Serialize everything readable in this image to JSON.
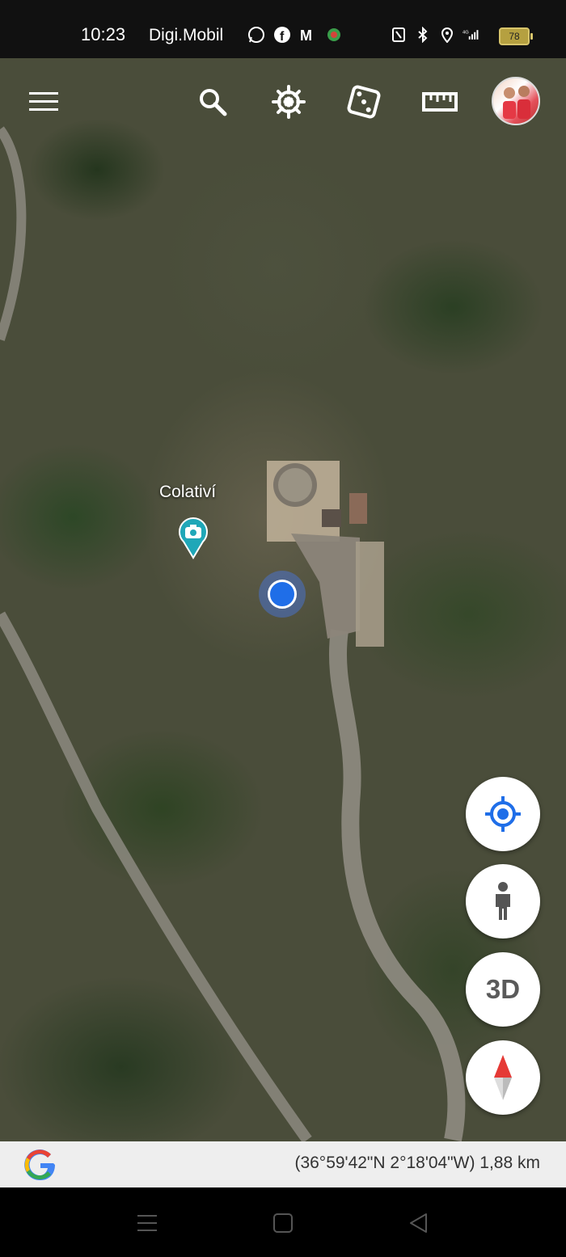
{
  "status_bar": {
    "time": "10:23",
    "carrier": "Digi.Mobil",
    "battery_level": "78",
    "app_icons": [
      "whatsapp-icon",
      "facebook-icon",
      "gmail-icon",
      "app-notification-icon"
    ],
    "system_icons": [
      "nfc-icon",
      "bluetooth-icon",
      "location-icon",
      "signal-4g-icon"
    ]
  },
  "toolbar": {
    "menu": "menu-icon",
    "search": "search-icon",
    "voyager": "ship-wheel-icon",
    "feeling_lucky": "dice-icon",
    "measure": "ruler-icon",
    "account": "account-avatar"
  },
  "map": {
    "place_label": "Colativí",
    "place_marker": "photo-marker",
    "my_location": "current-location-dot"
  },
  "controls": {
    "locate": "my-location-icon",
    "street_view": "pegman-icon",
    "view_3d_label": "3D",
    "compass": "compass-icon"
  },
  "footer": {
    "logo": "google-g-logo",
    "coordinates": "(36°59'42\"N 2°18'04\"W) 1,88 km"
  },
  "navigation": {
    "recents": "recent-apps-icon",
    "home": "home-icon",
    "back": "back-icon"
  },
  "colors": {
    "accent_blue": "#1f6ee8",
    "pin_teal": "#1fa7b8",
    "compass_red": "#e53935"
  }
}
